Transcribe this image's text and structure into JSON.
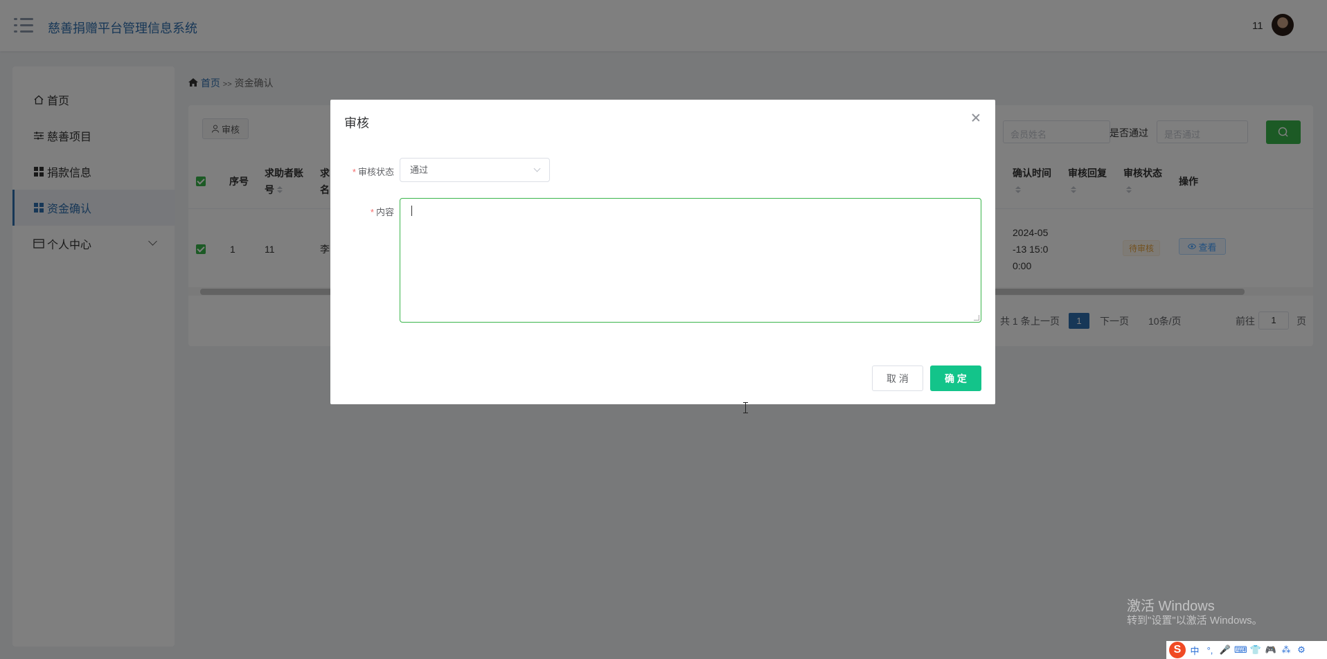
{
  "header": {
    "title": "慈善捐赠平台管理信息系统",
    "user": "11"
  },
  "sidebar": {
    "items": [
      {
        "label": "首页",
        "icon": "home-icon"
      },
      {
        "label": "慈善项目",
        "icon": "sliders-icon"
      },
      {
        "label": "捐款信息",
        "icon": "grid-icon"
      },
      {
        "label": "资金确认",
        "icon": "grid-icon",
        "active": true
      },
      {
        "label": "个人中心",
        "icon": "wallet-icon"
      }
    ]
  },
  "breadcrumb": {
    "home": "首页",
    "sep": ">>",
    "current": "资金确认"
  },
  "toolbar": {
    "audit_button": "审核"
  },
  "filters": {
    "member_placeholder": "会员姓名",
    "pass_label": "是否通过",
    "pass_placeholder": "是否通过"
  },
  "table": {
    "headers": [
      {
        "text": "序号"
      },
      {
        "text": "求助者账号",
        "line1": "求助者账",
        "line2": "号"
      },
      {
        "text": "求",
        "line1": "求",
        "line2": "名"
      },
      {
        "text": "确认时间"
      },
      {
        "text": "审核回复"
      },
      {
        "text": "审核状态"
      },
      {
        "text": "操作"
      }
    ],
    "rows": [
      {
        "index": "1",
        "account": "11",
        "name": "李",
        "confirm_time_l1": "2024-05",
        "confirm_time_l2": "-13 15:0",
        "confirm_time_l3": "0:00",
        "status": "待审核",
        "action": "查看"
      }
    ]
  },
  "pagination": {
    "total": "1 条",
    "prev": "上一页",
    "page": "1",
    "next": "下一页",
    "page_size": "10条/页",
    "goto_label": "前往",
    "goto_value": "1",
    "goto_unit": "页"
  },
  "dialog": {
    "title": "审核",
    "status_label": "审核状态",
    "status_value": "通过",
    "content_label": "内容",
    "cancel": "取 消",
    "confirm": "确 定"
  },
  "watermark": {
    "line1": "激活 Windows",
    "line2": "转到\"设置\"以激活 Windows。"
  },
  "ime": {
    "logo": "S",
    "items": [
      "中",
      "°,",
      "🎤",
      "⌨",
      "👕",
      "🎮",
      "⁂",
      "⚙"
    ]
  },
  "colors": {
    "primary": "#2f6fae",
    "success": "#39b54a",
    "confirm": "#13c48a",
    "warning": "#e6a23c"
  }
}
